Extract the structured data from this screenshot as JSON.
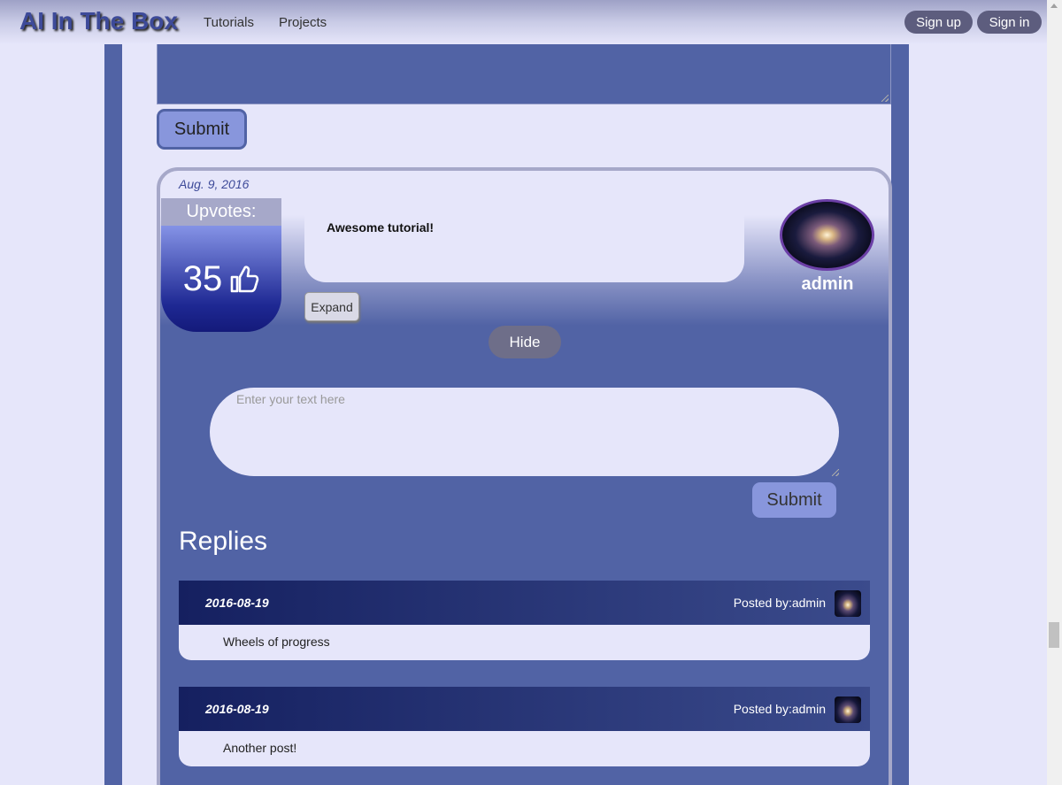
{
  "nav": {
    "brand": "AI In The Box",
    "links": [
      "Tutorials",
      "Projects"
    ],
    "signup": "Sign up",
    "signin": "Sign in"
  },
  "form": {
    "submit_label": "Submit"
  },
  "comment": {
    "date": "Aug. 9, 2016",
    "upvotes_label": "Upvotes:",
    "upvotes_count": "35",
    "text": "Awesome tutorial!",
    "expand_label": "Expand",
    "author": "admin",
    "hide_label": "Hide",
    "reply_placeholder": "Enter your text here",
    "reply_submit": "Submit",
    "replies_title": "Replies",
    "replies": [
      {
        "date": "2016-08-19",
        "posted_by": "Posted by:admin",
        "text": "Wheels of progress"
      },
      {
        "date": "2016-08-19",
        "posted_by": "Posted by:admin",
        "text": "Another post!"
      }
    ]
  },
  "icons": {
    "thumbs_up": "thumbs-up-icon",
    "avatar": "galaxy-avatar"
  },
  "colors": {
    "page_bg": "#e6e6fa",
    "column": "#5163a5",
    "accent_button": "#8896dc",
    "pill_button": "#5d5d7e",
    "upvote_gradient_end": "#141a7a"
  }
}
